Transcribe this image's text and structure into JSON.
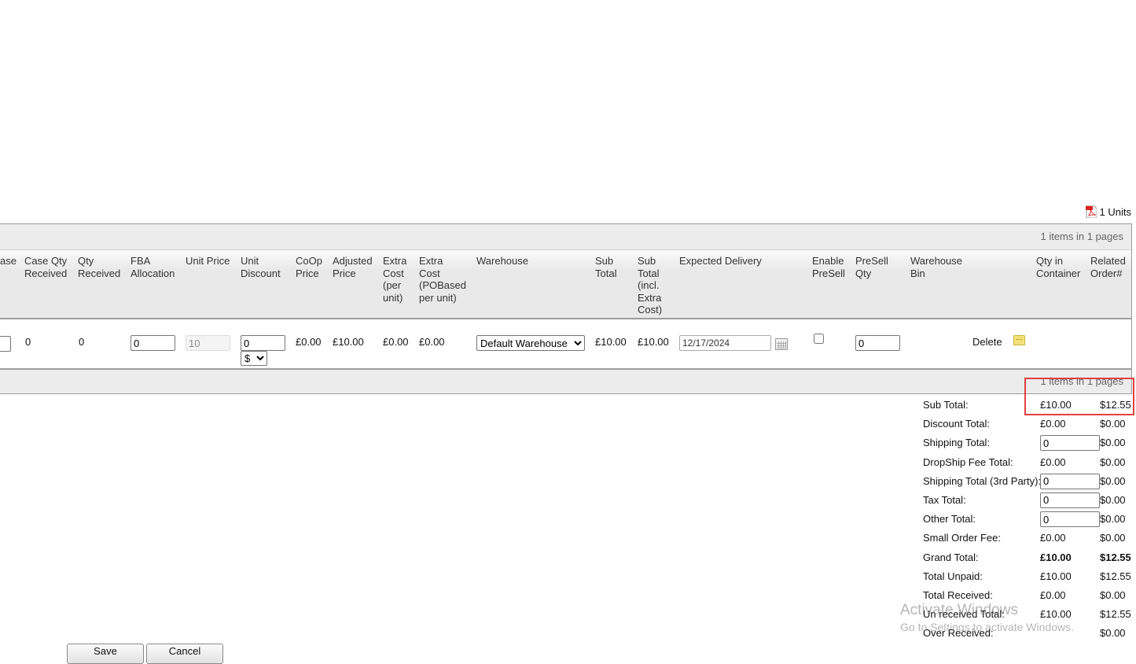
{
  "summary": {
    "units_label": "1 Units",
    "pager_text": "1 items in 1 pages"
  },
  "columns": [
    {
      "key": "case",
      "label": "ase"
    },
    {
      "key": "case_qty_received",
      "label": "Case Qty\nReceived"
    },
    {
      "key": "qty_received",
      "label": "Qty\nReceived"
    },
    {
      "key": "fba_allocation",
      "label": "FBA\nAllocation"
    },
    {
      "key": "unit_price",
      "label": "Unit Price"
    },
    {
      "key": "unit_discount",
      "label": "Unit\nDiscount"
    },
    {
      "key": "coop_price",
      "label": "CoOp\nPrice"
    },
    {
      "key": "adjusted_price",
      "label": "Adjusted\nPrice"
    },
    {
      "key": "extra_cost_unit",
      "label": "Extra\nCost\n(per\nunit)"
    },
    {
      "key": "extra_cost_po",
      "label": "Extra\nCost\n(POBased\nper unit)"
    },
    {
      "key": "warehouse",
      "label": "Warehouse"
    },
    {
      "key": "sub_total",
      "label": "Sub\nTotal"
    },
    {
      "key": "sub_total_incl",
      "label": "Sub\nTotal\n(incl.\nExtra\nCost)"
    },
    {
      "key": "expected_delivery",
      "label": "Expected Delivery"
    },
    {
      "key": "enable_presell",
      "label": "Enable\nPreSell"
    },
    {
      "key": "presell_qty",
      "label": "PreSell\nQty"
    },
    {
      "key": "warehouse_bin",
      "label": "Warehouse\nBin"
    },
    {
      "key": "qty_in_container",
      "label": "Qty in\nContainer"
    },
    {
      "key": "related_order",
      "label": "Related\nOrder#"
    }
  ],
  "row": {
    "case_value": "",
    "case_qty_received": "0",
    "qty_received": "0",
    "fba_allocation": "0",
    "unit_price": "10",
    "unit_discount": "0",
    "discount_currency": "$",
    "coop_price": "£0.00",
    "adjusted_price": "£10.00",
    "extra_cost_unit": "£0.00",
    "extra_cost_po": "£0.00",
    "warehouse": "Default Warehouse",
    "sub_total": "£10.00",
    "sub_total_incl": "£10.00",
    "expected_delivery": "12/17/2024",
    "enable_presell": false,
    "presell_qty": "0",
    "delete_label": "Delete"
  },
  "totals": [
    {
      "label": "Sub Total:",
      "gbp": "£10.00",
      "usd": "$12.55"
    },
    {
      "label": "Discount Total:",
      "gbp": "£0.00",
      "usd": "$0.00"
    },
    {
      "label": "Shipping Total:",
      "input": "0",
      "usd": "$0.00"
    },
    {
      "label": "DropShip Fee Total:",
      "gbp": "£0.00",
      "usd": "$0.00"
    },
    {
      "label": "Shipping Total (3rd Party):",
      "input": "0",
      "usd": "$0.00"
    },
    {
      "label": "Tax Total:",
      "input": "0",
      "usd": "$0.00"
    },
    {
      "label": "Other Total:",
      "input": "0",
      "usd": "$0.00"
    },
    {
      "label": "Small Order Fee:",
      "gbp": "£0.00",
      "usd": "$0.00"
    },
    {
      "label": "Grand Total:",
      "gbp": "£10.00",
      "usd": "$12.55",
      "bold": true
    },
    {
      "label": "Total Unpaid:",
      "gbp": "£10.00",
      "usd": "$12.55"
    },
    {
      "label": "Total Received:",
      "gbp": "£0.00",
      "usd": "$0.00"
    },
    {
      "label": "Un received Total:",
      "gbp": "£10.00",
      "usd": "$12.55"
    },
    {
      "label": "Over Received:",
      "gbp": "",
      "usd": "$0.00"
    }
  ],
  "buttons": {
    "save": "Save",
    "cancel": "Cancel"
  },
  "watermark": {
    "line1": "Activate Windows",
    "line2": "Go to Settings to activate Windows."
  },
  "colors": {
    "highlight": "#e34040",
    "header_bg": "#e9e9e9"
  }
}
